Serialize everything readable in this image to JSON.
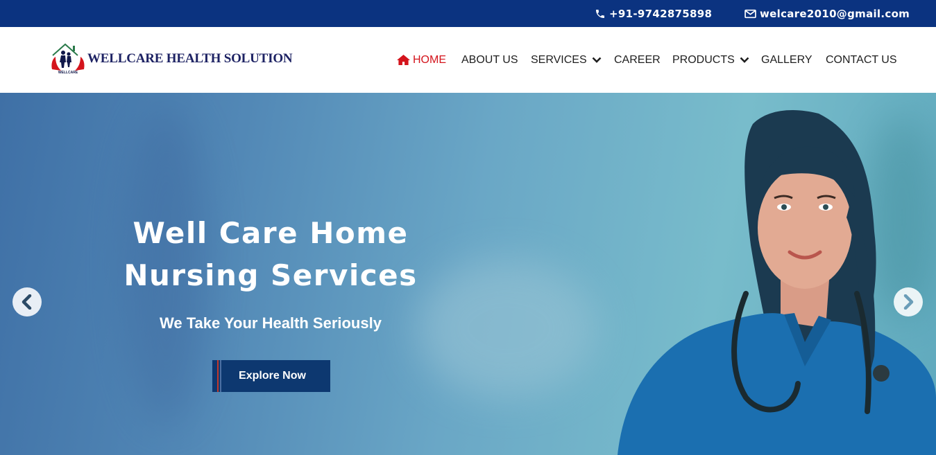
{
  "topbar": {
    "phone": "+91-9742875898",
    "email": "welcare2010@gmail.com",
    "icons": [
      "phone-icon",
      "envelope-icon"
    ]
  },
  "header": {
    "brand": "WELLCARE HEALTH SOLUTION",
    "logo_text": "WELLCARE"
  },
  "nav": {
    "items": [
      {
        "label": "HOME",
        "active": true
      },
      {
        "label": "ABOUT US"
      },
      {
        "label": "SERVICES",
        "has_dropdown": true
      },
      {
        "label": "CAREER"
      },
      {
        "label": "PRODUCTS",
        "has_dropdown": true
      },
      {
        "label": "GALLERY"
      },
      {
        "label": "CONTACT US"
      }
    ]
  },
  "hero": {
    "title_line1": "Well Care Home",
    "title_line2": "Nursing Services",
    "subtitle": "We Take Your Health Seriously",
    "cta": "Explore Now"
  },
  "colors": {
    "topbar": "#0b3380",
    "active_nav": "#d4141c",
    "brand_text": "#1d2263",
    "cta_bg": "#0d3870"
  }
}
